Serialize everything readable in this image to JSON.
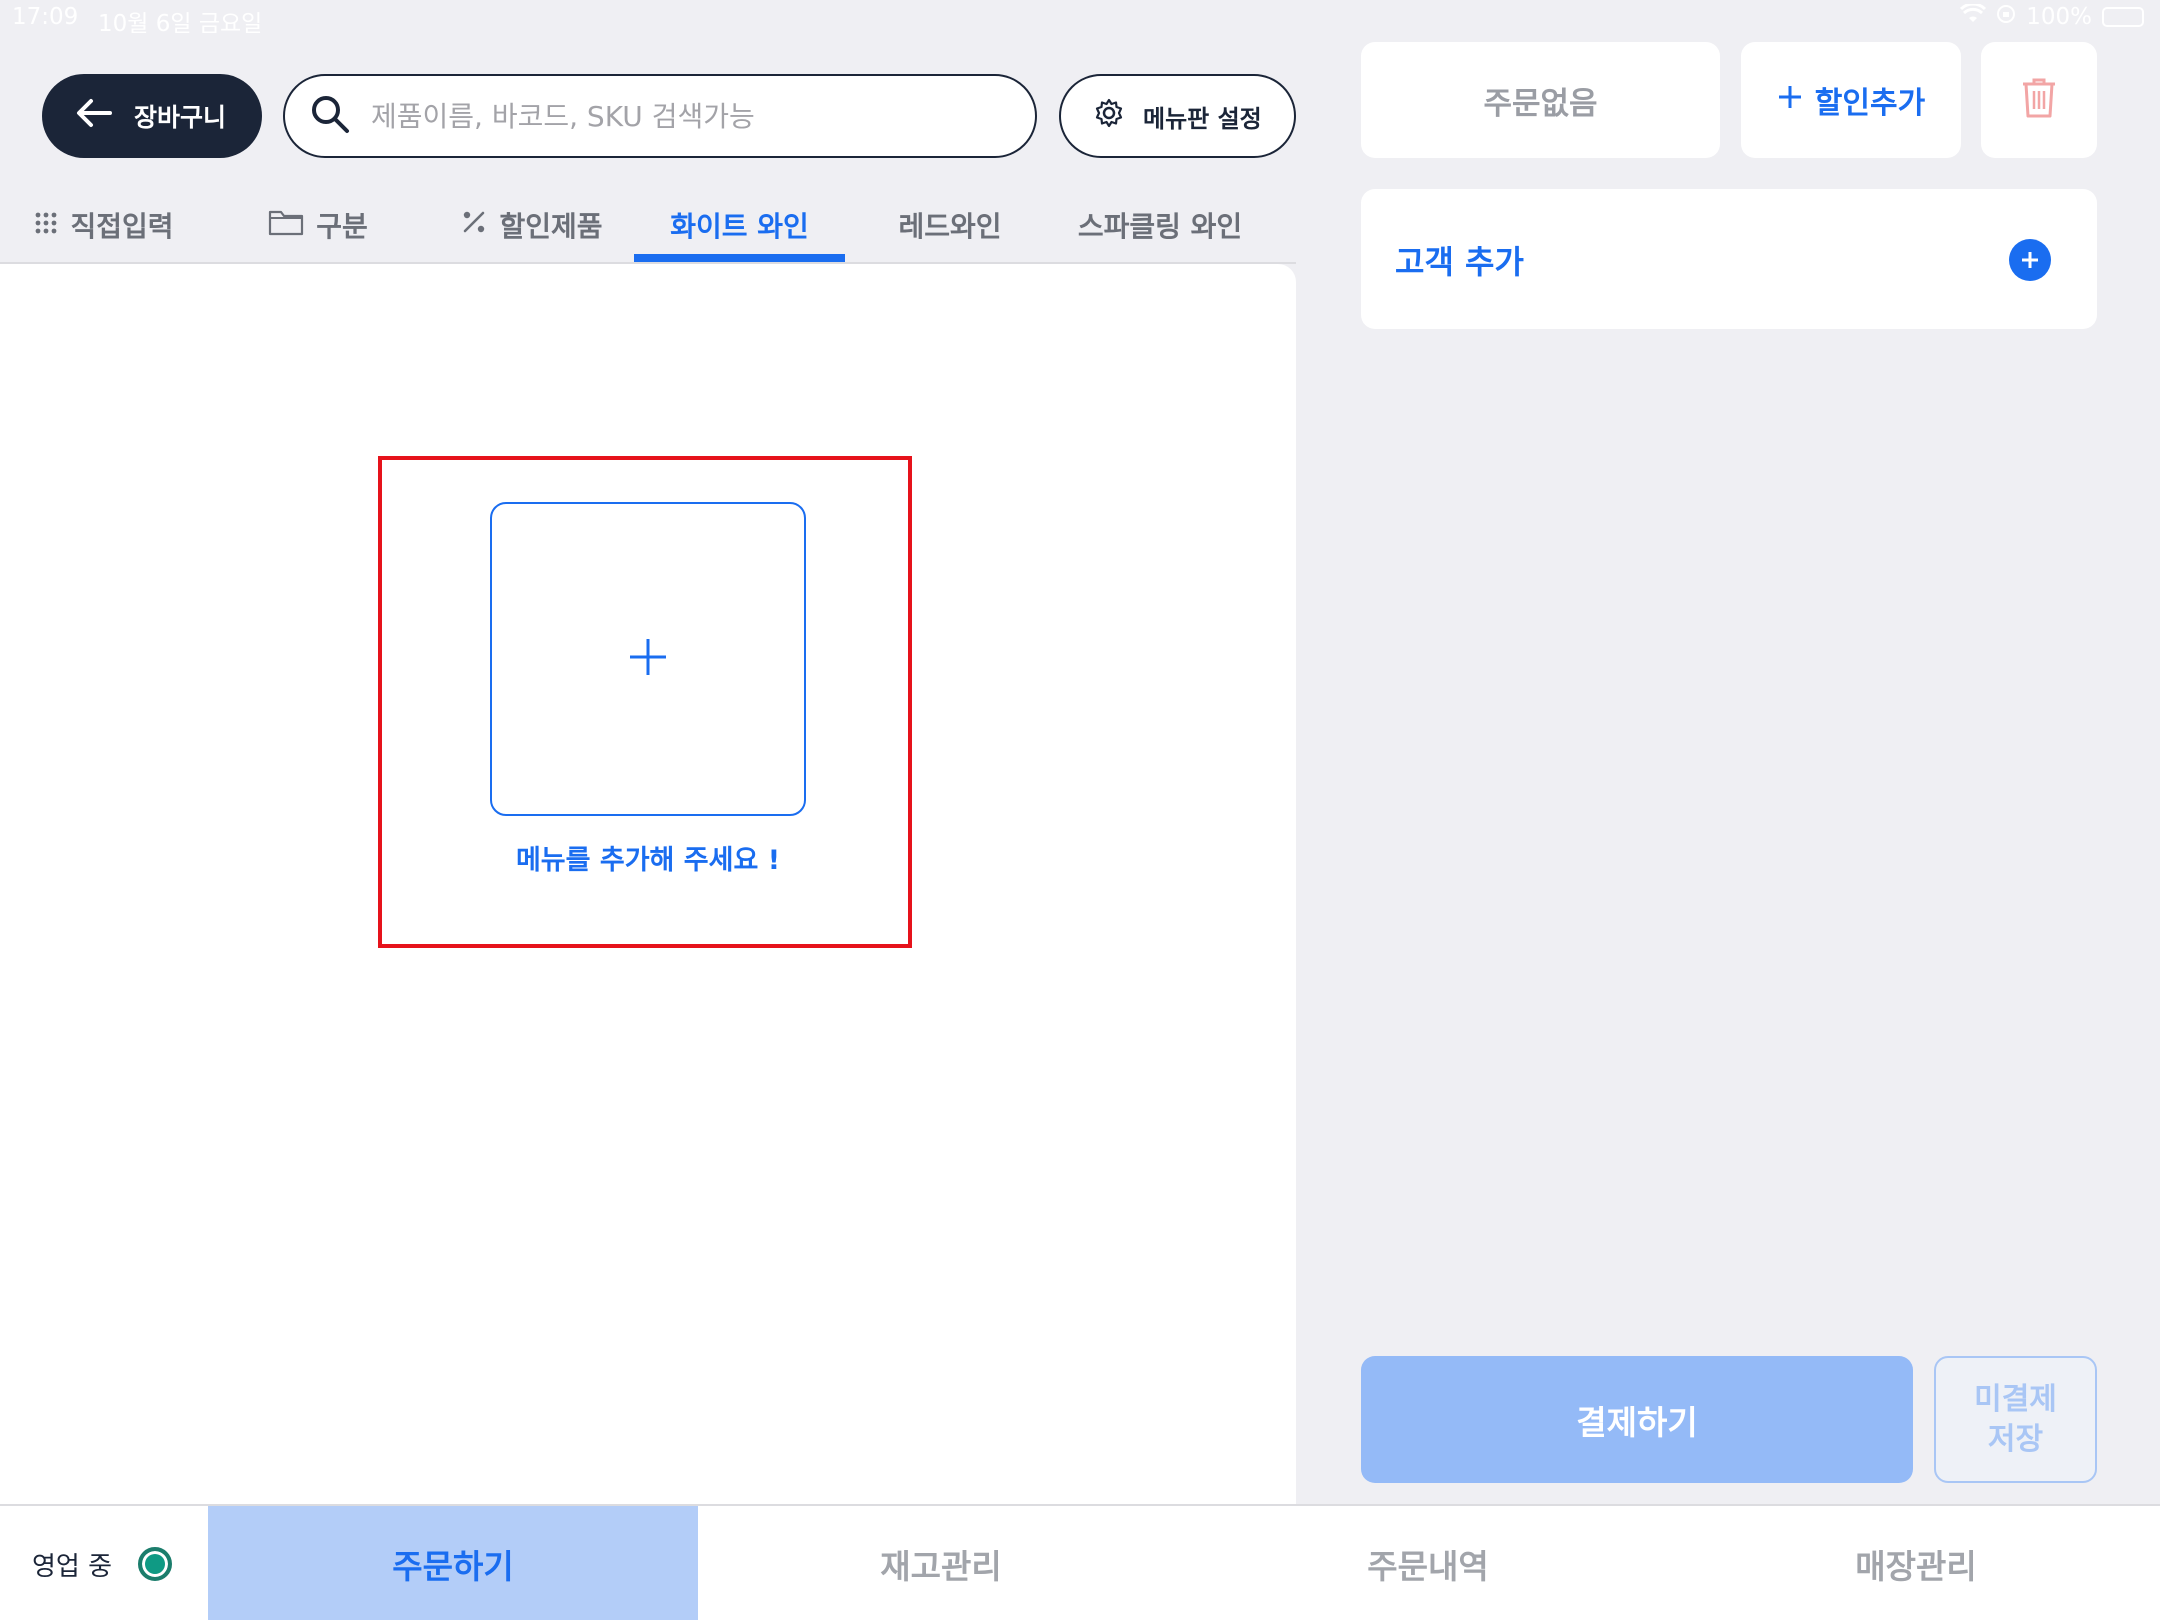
{
  "status_bar": {
    "time": "17:09",
    "date": "10월 6일 금요일",
    "battery": "100%"
  },
  "header": {
    "back_label": "장바구니",
    "search_placeholder": "제품이름, 바코드, SKU 검색가능",
    "menu_setting_label": "메뉴판 설정"
  },
  "tabs": [
    {
      "label": "직접입력",
      "icon": "keypad-icon"
    },
    {
      "label": "구분",
      "icon": "folder-icon"
    },
    {
      "label": "할인제품",
      "icon": "percent-icon"
    },
    {
      "label": "화이트 와인",
      "active": true
    },
    {
      "label": "레드와인"
    },
    {
      "label": "스파클링 와인"
    }
  ],
  "main": {
    "add_menu_text": "메뉴를 추가해 주세요 !"
  },
  "order_panel": {
    "order_status": "주문없음",
    "discount_label": "할인추가",
    "customer_label": "고객 추가",
    "pay_label": "결제하기",
    "unpaid_line1": "미결제",
    "unpaid_line2": "저장"
  },
  "bottom_nav": {
    "business_status": "영업 중",
    "items": [
      {
        "label": "주문하기",
        "active": true
      },
      {
        "label": "재고관리"
      },
      {
        "label": "주문내역"
      },
      {
        "label": "매장관리"
      }
    ]
  },
  "colors": {
    "accent": "#1a6df0",
    "dark": "#1b2538",
    "highlight": "#e6121b",
    "status_on": "#0f9a84"
  }
}
